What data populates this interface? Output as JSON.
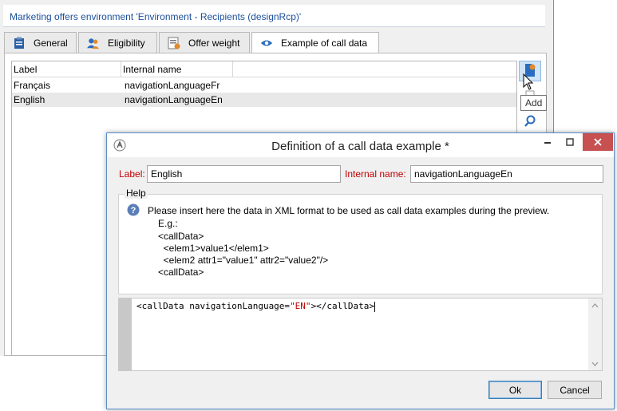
{
  "background_window": {
    "title": "Marketing offers environment 'Environment - Recipients (designRcp)'",
    "tabs": [
      {
        "label": "General",
        "icon": "clipboard-icon"
      },
      {
        "label": "Eligibility",
        "icon": "users-icon"
      },
      {
        "label": "Offer weight",
        "icon": "weight-list-icon"
      },
      {
        "label": "Example of call data",
        "icon": "eye-icon",
        "active": true
      }
    ],
    "grid": {
      "columns": [
        "Label",
        "Internal name"
      ],
      "rows": [
        {
          "label": "Français",
          "internal_name": "navigationLanguageFr"
        },
        {
          "label": "English",
          "internal_name": "navigationLanguageEn",
          "selected": true
        }
      ]
    },
    "tools": [
      "add-icon",
      "delete-icon",
      "search-icon"
    ],
    "tooltip": "Add"
  },
  "dialog": {
    "title": "Definition of a call data example *",
    "label_caption": "Label:",
    "label_value": "English",
    "internal_name_caption": "Internal name:",
    "internal_name_value": "navigationLanguageEn",
    "help": {
      "legend": "Help",
      "text": "Please insert here the data in XML format to be used as call data examples during the preview.",
      "example_lines": [
        "E.g.:",
        "<callData>",
        "  <elem1>value1</elem1>",
        "  <elem2 attr1=\"value1\" attr2=\"value2\"/>",
        "<callData>"
      ]
    },
    "editor": {
      "before": "<callData navigationLanguage=",
      "attr_value": "\"EN\"",
      "after": "></callData>"
    },
    "ok_label": "Ok",
    "cancel_label": "Cancel"
  },
  "colors": {
    "accent": "#1c4f9b",
    "required_label": "#c00000",
    "close_button": "#c75050",
    "selection": "#e8e8e8"
  }
}
